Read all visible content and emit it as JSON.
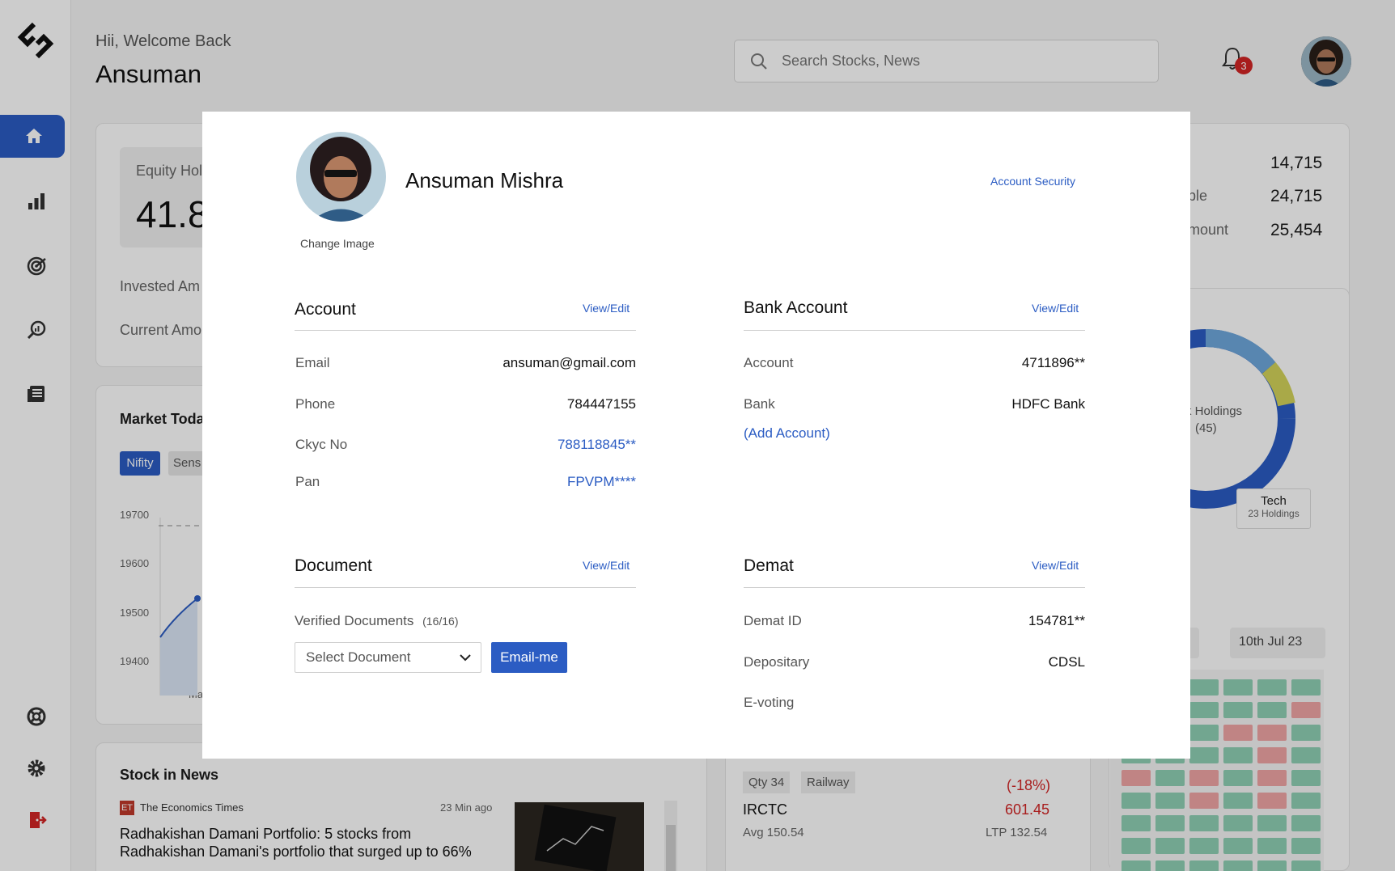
{
  "header": {
    "greeting": "Hii, Welcome Back",
    "user_name": "Ansuman",
    "search_placeholder": "Search Stocks, News",
    "notification_count": "3"
  },
  "sidebar": {
    "items": [
      {
        "name": "home",
        "icon": "home-icon",
        "active": true
      },
      {
        "name": "charts",
        "icon": "bar-chart-icon"
      },
      {
        "name": "radar",
        "icon": "radar-icon"
      },
      {
        "name": "research",
        "icon": "search-analytics-icon"
      },
      {
        "name": "news",
        "icon": "newspaper-icon"
      },
      {
        "name": "support",
        "icon": "lifebuoy-icon"
      },
      {
        "name": "settings",
        "icon": "gear-icon"
      },
      {
        "name": "logout",
        "icon": "logout-icon"
      }
    ]
  },
  "background": {
    "holdings_card": {
      "equity_label": "Equity Hol",
      "equity_value": "41.8",
      "invested_label": "Invested Am",
      "current_label": "Current Amo"
    },
    "stats": [
      {
        "label": "",
        "value": "14,715"
      },
      {
        "label": "ble",
        "value": "24,715"
      },
      {
        "label": "mount",
        "value": "25,454"
      }
    ],
    "market": {
      "title": "Market Toda",
      "tabs": [
        "Nifity",
        "Sens"
      ],
      "y_ticks": [
        "19700",
        "19600",
        "19500",
        "19400"
      ],
      "x_tick": "Ma"
    },
    "donut": {
      "center_label": "k Holdings",
      "center_count": "(45)",
      "tooltip_title": "Tech",
      "tooltip_sub": "23 Holdings"
    },
    "date_chip": "10th Jul 23",
    "news": {
      "title": "Stock in News",
      "source": "The Economics Times",
      "time": "23 Min ago",
      "headline": "Radhakishan Damani Portfolio: 5 stocks from Radhakishan Damani's portfolio that surged up to 66%"
    },
    "trade": {
      "qty": "Qty 34",
      "tag": "Railway",
      "change": "(-18%)",
      "name": "IRCTC",
      "price": "601.45",
      "avg": "Avg 150.54",
      "ltp": "LTP 132.54"
    }
  },
  "profile_modal": {
    "full_name": "Ansuman Mishra",
    "change_image": "Change Image",
    "account_security": "Account Security",
    "account": {
      "title": "Account",
      "edit": "View/Edit",
      "rows": [
        {
          "label": "Email",
          "value": "ansuman@gmail.com"
        },
        {
          "label": "Phone",
          "value": "784447155"
        },
        {
          "label": "Ckyc No",
          "value": "788118845**"
        },
        {
          "label": "Pan",
          "value": "FPVPM****"
        }
      ]
    },
    "bank": {
      "title": "Bank Account",
      "edit": "View/Edit",
      "rows": [
        {
          "label": "Account",
          "value": "4711896**"
        },
        {
          "label": "Bank",
          "value": "HDFC Bank"
        }
      ],
      "add_account": "(Add Account)"
    },
    "document": {
      "title": "Document",
      "edit": "View/Edit",
      "verified_label": "Verified Documents",
      "verified_count": "(16/16)",
      "select_placeholder": "Select Document",
      "email_button": "Email-me"
    },
    "demat": {
      "title": "Demat",
      "edit": "View/Edit",
      "rows": [
        {
          "label": "Demat ID",
          "value": "154781**"
        },
        {
          "label": "Depositary",
          "value": "CDSL"
        },
        {
          "label": "E-voting",
          "value": ""
        }
      ]
    }
  },
  "colors": {
    "accent": "#2b5cc3",
    "danger": "#d32525",
    "tile_green": "#8fd0b4",
    "tile_red": "#f0a6a6"
  }
}
